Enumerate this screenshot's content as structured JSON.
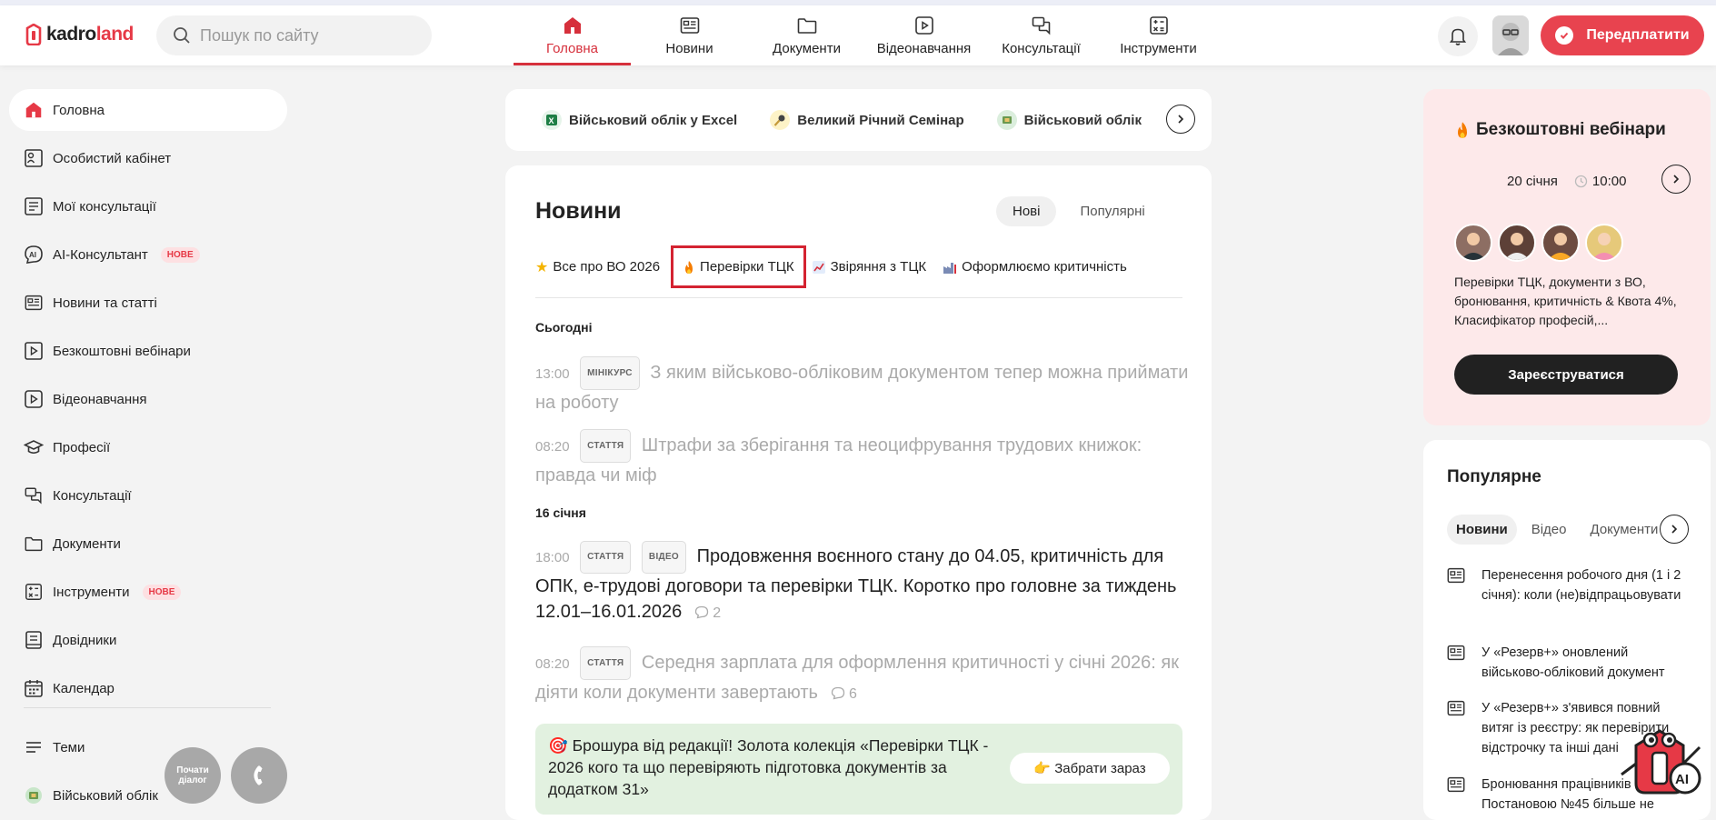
{
  "header": {
    "logo_k": "kadro",
    "logo_l": "land",
    "search_placeholder": "Пошук по сайту",
    "nav": [
      {
        "label": "Головна",
        "icon": "home-icon"
      },
      {
        "label": "Новини",
        "icon": "news-icon"
      },
      {
        "label": "Документи",
        "icon": "folder-icon"
      },
      {
        "label": "Відеонавчання",
        "icon": "video-icon"
      },
      {
        "label": "Консультації",
        "icon": "chat-icon"
      },
      {
        "label": "Інструменти",
        "icon": "tools-icon"
      }
    ],
    "subscribe_label": "Передплатити"
  },
  "sidebar": {
    "items": [
      {
        "label": "Головна"
      },
      {
        "label": "Особистий кабінет"
      },
      {
        "label": "Мої консультації"
      },
      {
        "label": "AI-Консультант",
        "badge": "НОВЕ"
      },
      {
        "label": "Новини та статті"
      },
      {
        "label": "Безкоштовні вебінари"
      },
      {
        "label": "Відеонавчання"
      },
      {
        "label": "Професії"
      },
      {
        "label": "Консультації"
      },
      {
        "label": "Документи"
      },
      {
        "label": "Інструменти",
        "badge": "НОВЕ"
      },
      {
        "label": "Довідники"
      },
      {
        "label": "Календар"
      },
      {
        "label": "Теми"
      },
      {
        "label": "Військовий облік"
      }
    ],
    "float_dialog": "Почати діалог"
  },
  "promo": {
    "items": [
      "Військовий облік у Excel",
      "Великий Річний Семінар",
      "Військовий облік"
    ]
  },
  "news": {
    "title": "Новини",
    "toggle": [
      "Нові",
      "Популярні"
    ],
    "tags": [
      "Все про ВО 2026",
      "Перевірки ТЦК",
      "Звіряння з ТЦК",
      "Оформлюємо критичність"
    ],
    "day_today": "Сьогодні",
    "day_16": "16 січня",
    "items": [
      {
        "time": "13:00",
        "chips": [
          "МІНІКУРС"
        ],
        "title": "З яким військово-обліковим документом тепер можна приймати на роботу"
      },
      {
        "time": "08:20",
        "chips": [
          "СТАТТЯ"
        ],
        "title": "Штрафи за зберігання та неоцифрування трудових книжок: правда чи міф"
      },
      {
        "time": "18:00",
        "chips": [
          "СТАТТЯ",
          "ВІДЕО"
        ],
        "title": "Продовження воєнного стану до 04.05, критичність для ОПК, е-трудові договори та перевірки ТЦК. Коротко про головне за тиждень 12.01–16.01.2026",
        "comments": "2"
      },
      {
        "time": "08:20",
        "chips": [
          "СТАТТЯ"
        ],
        "title": "Середня зарплата для оформлення критичності у січні 2026: як діяти коли документи завертають",
        "comments": "6"
      }
    ],
    "brochure_text": "🎯 Брошура від редакції! Золота колекція «Перевірки ТЦК - 2026 кого та що перевіряють підготовка документів за додатком 31»",
    "brochure_btn": "👉 Забрати зараз"
  },
  "webinar": {
    "title": "Безкоштовні вебінари",
    "date": "20 січня",
    "time": "10:00",
    "desc": "Перевірки ТЦК, документи з ВО, бронювання, критичність & Квота 4%, Класифікатор професій,...",
    "register": "Зареєструватися"
  },
  "popular": {
    "title": "Популярне",
    "tabs": [
      "Новини",
      "Відео",
      "Документи"
    ],
    "items": [
      "Перенесення робочого дня (1 і 2 січня): коли (не)відпрацьовувати",
      "У «Резерв+» оновлений військово-обліковий документ",
      "У «Резерв+» з'явився повний витяг із реєстру: як перевірити відстрочку та інші дані",
      "Бронювання працівників за Постановою №45 більше не"
    ]
  },
  "colors": {
    "accent": "#e63946",
    "webinar_bg": "#fde9ea",
    "brochure_bg": "#e2f1e0"
  }
}
